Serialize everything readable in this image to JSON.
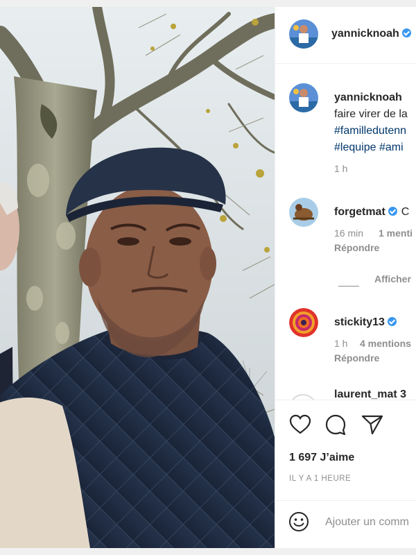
{
  "post": {
    "image_alt": "Selfie of a man in a flat cap and quilted navy vest beside a plane tree",
    "author": "yannicknoah"
  },
  "caption": {
    "author": "yannicknoah",
    "line1": "faire virer de la",
    "hashtags_line1": "#familledutenn",
    "hashtags_line2": "#lequipe #ami",
    "time": "1 h"
  },
  "comments": [
    {
      "author": "forgetmat",
      "text": "C",
      "time": "16 min",
      "meta": "1 menti",
      "reply": "Répondre"
    },
    {
      "author": "stickity13",
      "time": "1 h",
      "meta": "4 mentions",
      "reply": "Répondre"
    },
    {
      "author": "laurent_mat 3"
    }
  ],
  "view_replies": "Afficher",
  "likes": "1 697 J’aime",
  "timestamp": "IL Y A 1 HEURE",
  "add_comment_placeholder": "Ajouter un comm",
  "colors": {
    "verified": "#3897f0",
    "hashtag": "#00376b",
    "secondary_text": "#8e8e8e"
  },
  "icons": [
    "heart-icon",
    "comment-icon",
    "share-icon",
    "emoji-icon",
    "verified-icon"
  ]
}
